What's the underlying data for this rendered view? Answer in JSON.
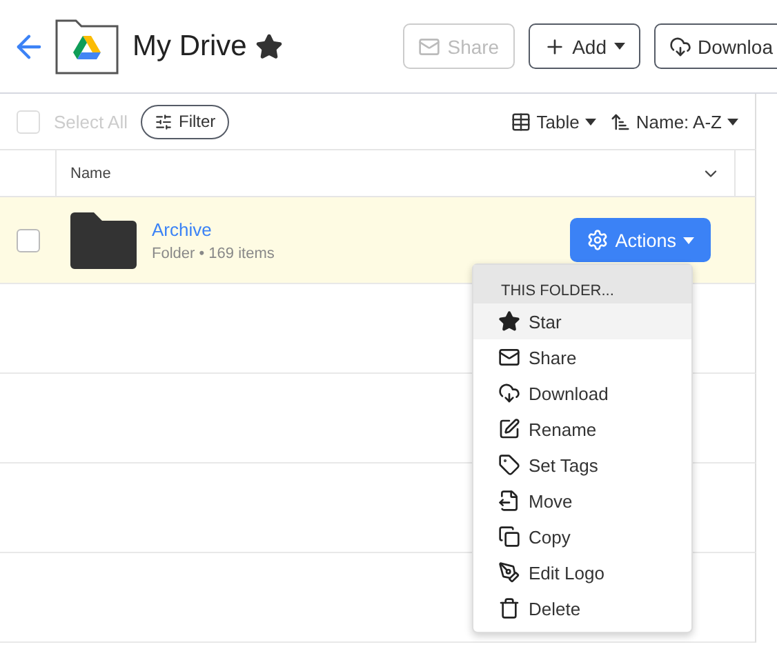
{
  "header": {
    "title": "My Drive",
    "starred": true,
    "buttons": [
      {
        "kind": "share",
        "label": "Share",
        "disabled": true
      },
      {
        "kind": "add",
        "label": "Add",
        "disabled": false
      },
      {
        "kind": "download",
        "label": "Downloa",
        "disabled": false
      }
    ]
  },
  "toolbar": {
    "select_all": {
      "label": "Select All",
      "checked": false,
      "disabled": true
    },
    "filter": "Filter",
    "view": "Table",
    "sort": "Name: A-Z"
  },
  "table": {
    "columns": [
      "Name"
    ],
    "rows": [
      {
        "name": "Archive",
        "type": "Folder",
        "separator": "•",
        "count": "169 items",
        "selected": true,
        "checked": false,
        "action": "Actions"
      }
    ]
  },
  "menu": {
    "heading": "THIS FOLDER...",
    "items": [
      {
        "kind": "star",
        "label": "Star",
        "selected": true
      },
      {
        "kind": "share",
        "label": "Share",
        "selected": false
      },
      {
        "kind": "download",
        "label": "Download",
        "selected": false
      },
      {
        "kind": "rename",
        "label": "Rename",
        "selected": false
      },
      {
        "kind": "tags",
        "label": "Set Tags",
        "selected": false
      },
      {
        "kind": "move",
        "label": "Move",
        "selected": false
      },
      {
        "kind": "copy",
        "label": "Copy",
        "selected": false
      },
      {
        "kind": "logo",
        "label": "Edit Logo",
        "selected": false
      },
      {
        "kind": "delete",
        "label": "Delete",
        "selected": false
      }
    ]
  }
}
